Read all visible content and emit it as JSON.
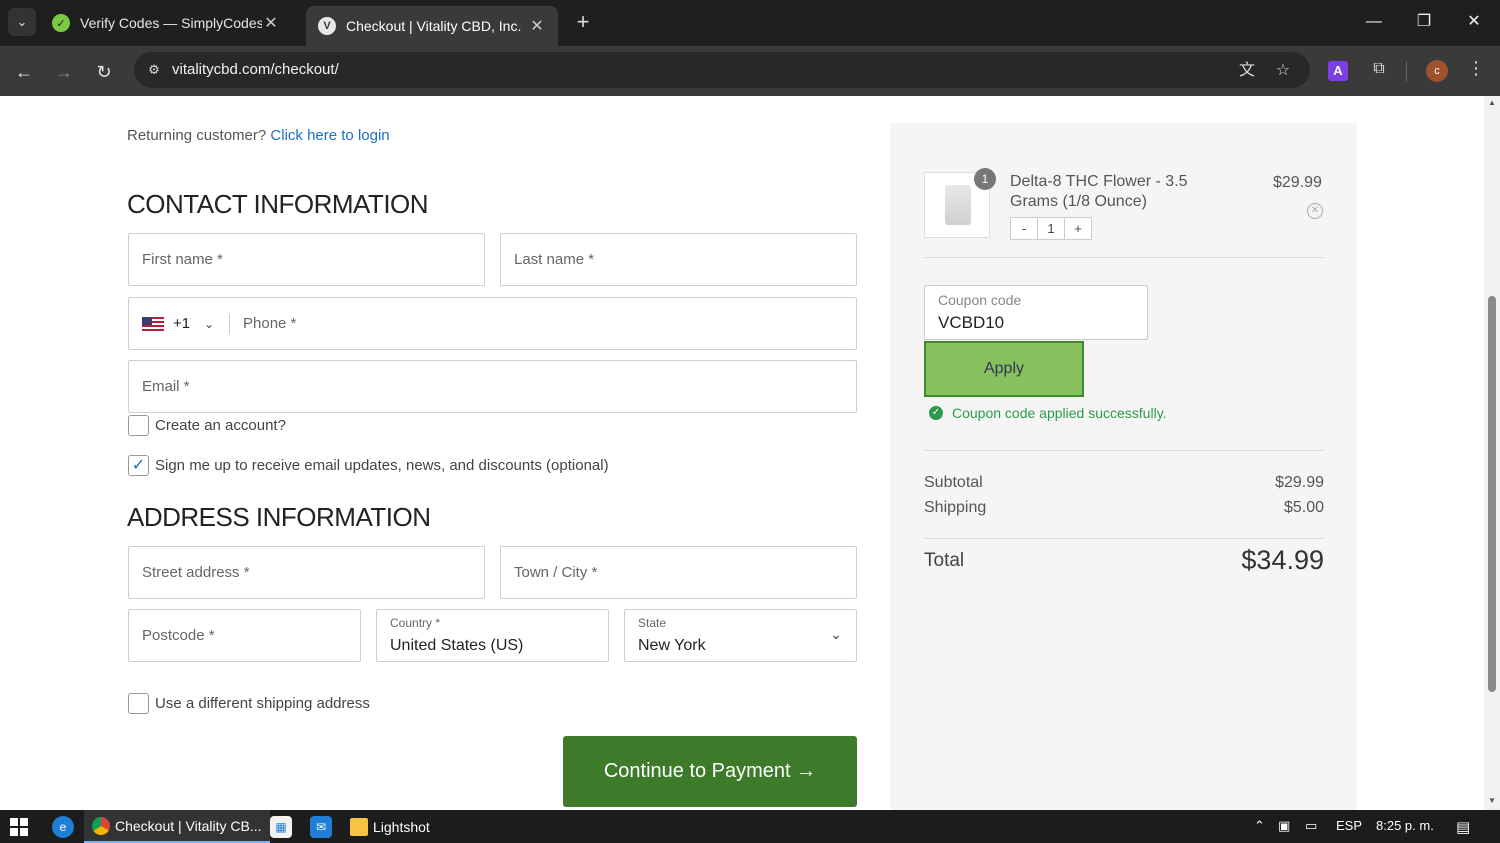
{
  "browser": {
    "tabs": [
      {
        "title": "Verify Codes — SimplyCodes",
        "active": false
      },
      {
        "title": "Checkout | Vitality CBD, Inc.",
        "active": true
      }
    ],
    "url": "vitalitycbd.com/checkout/",
    "profile_initial": "c",
    "extension_letter": "A"
  },
  "checkout": {
    "returning_text": "Returning customer?",
    "login_link": "Click here to login",
    "contact_title": "CONTACT INFORMATION",
    "first_name_ph": "First name *",
    "last_name_ph": "Last name *",
    "phone_code": "+1",
    "phone_ph": "Phone *",
    "email_ph": "Email *",
    "create_account_label": "Create an account?",
    "create_account_checked": false,
    "newsletter_label": "Sign me up to receive email updates, news, and discounts (optional)",
    "newsletter_checked": true,
    "address_title": "ADDRESS INFORMATION",
    "street_ph": "Street address *",
    "city_ph": "Town / City *",
    "postcode_ph": "Postcode *",
    "country_label": "Country *",
    "country_value": "United States (US)",
    "state_label": "State",
    "state_value": "New York",
    "diff_shipping_label": "Use a different shipping address",
    "continue_label": "Continue to Payment →"
  },
  "summary": {
    "product": {
      "name": "Delta-8 THC Flower - 3.5 Grams (1/8 Ounce)",
      "price": "$29.99",
      "qty": "1",
      "badge": "1",
      "minus": "-",
      "plus": "+"
    },
    "coupon_label": "Coupon code",
    "coupon_value": "VCBD10",
    "apply_label": "Apply",
    "success_msg": "Coupon code applied successfully.",
    "subtotal_label": "Subtotal",
    "subtotal_value": "$29.99",
    "shipping_label": "Shipping",
    "shipping_value": "$5.00",
    "total_label": "Total",
    "total_value": "$34.99"
  },
  "taskbar": {
    "chrome_app": "Checkout | Vitality CB...",
    "folder_app": "Lightshot",
    "lang": "ESP",
    "time": "8:25 p. m."
  },
  "colors": {
    "continue_button": "#3d7a2a",
    "apply_button": "#86c15e",
    "link": "#1a6fc9",
    "success": "#2b9a4c"
  }
}
